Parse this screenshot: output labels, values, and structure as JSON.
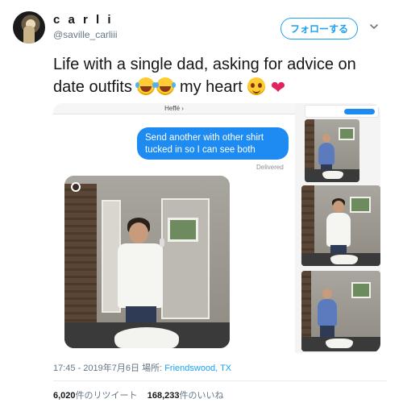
{
  "user": {
    "display_name": "c a r l i",
    "handle": "@saville_carliii",
    "follow_label": "フォローする"
  },
  "tweet": {
    "text_part1": "Life with a single dad, asking for advice on date outfits",
    "text_part2": "my heart",
    "emojis": [
      "laughing-crying",
      "laughing-crying",
      "smiling",
      "red-heart"
    ]
  },
  "media": {
    "chat_contact": "Heffé ›",
    "bubble_text": "Send another with other shirt tucked in so I can see both",
    "delivered_label": "Delivered"
  },
  "meta": {
    "timestamp": "17:45 - 2019年7月6日",
    "place_label": "場所:",
    "place": "Friendswood, TX"
  },
  "stats": {
    "retweets_count": "6,020",
    "retweets_label": "件のリツイート",
    "likes_count": "168,233",
    "likes_label": "件のいいね"
  },
  "colors": {
    "accent": "#1da1f2",
    "imessage_blue": "#1d8bf1",
    "heart": "#e0245e"
  }
}
